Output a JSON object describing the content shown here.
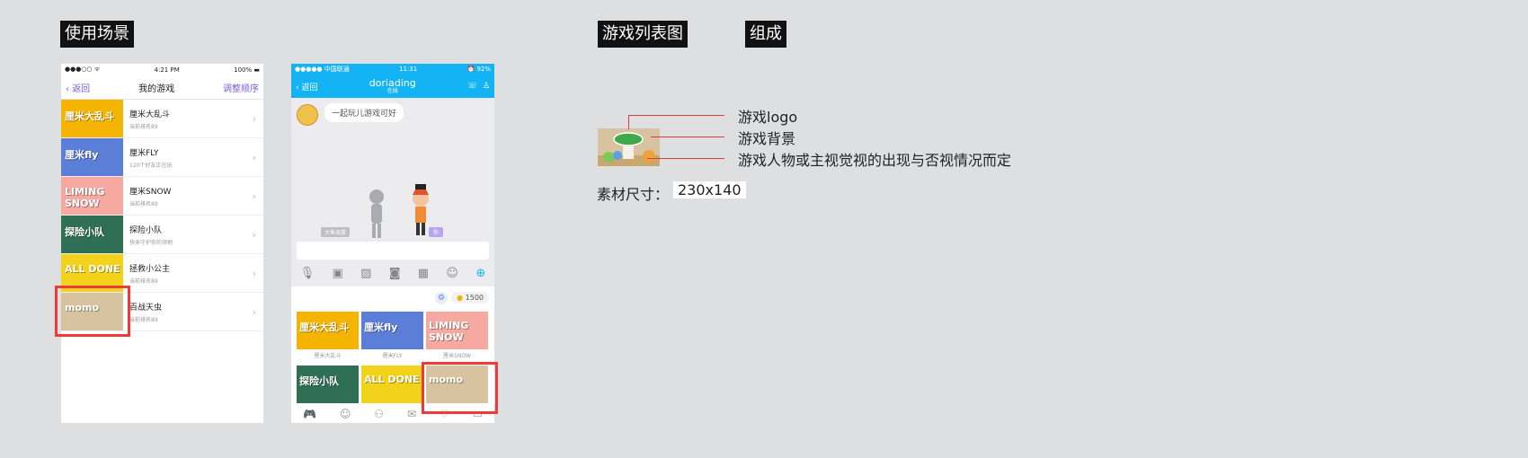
{
  "labels": {
    "usage": "使用场景",
    "list_icon": "游戏列表图",
    "composition": "组成"
  },
  "phone1": {
    "status_time": "4:21 PM",
    "status_battery": "100%",
    "back": "返回",
    "title": "我的游戏",
    "reorder": "调整顺序",
    "rows": [
      {
        "name": "厘米大乱斗",
        "sub": "当前排名89",
        "art": "厘米大乱斗",
        "color": "#f4b400"
      },
      {
        "name": "厘米FLY",
        "sub": "120个好友正在玩",
        "art": "厘米fly",
        "color": "#5b7ed9"
      },
      {
        "name": "厘米SNOW",
        "sub": "当前排名89",
        "art": "LIMING SNOW",
        "color": "#f6a9a0"
      },
      {
        "name": "探险小队",
        "sub": "快来守护你的领地",
        "art": "探险小队",
        "color": "#2f6f55"
      },
      {
        "name": "拯救小公主",
        "sub": "当前排名89",
        "art": "ALL DONE",
        "color": "#f3d21b"
      },
      {
        "name": "百战天虫",
        "sub": "当前排名89",
        "art": "momo",
        "color": "#d8c3a0"
      }
    ]
  },
  "phone2": {
    "status_carrier": "●●●●● 中国联通",
    "status_time": "11:31",
    "status_battery": "92%",
    "back": "返回",
    "title": "doriading",
    "subtitle": "在线",
    "bubble": "一起玩儿游戏可好",
    "left_tag": "大鱼海棠",
    "right_tag": "你",
    "coins": "1500",
    "tiles": [
      {
        "art": "厘米大乱斗",
        "caption": "厘米大乱斗",
        "color": "#f4b400"
      },
      {
        "art": "厘米fly",
        "caption": "厘米FLY",
        "color": "#5b7ed9"
      },
      {
        "art": "LIMING SNOW",
        "caption": "厘米SNOW",
        "color": "#f6a9a0"
      },
      {
        "art": "探险小队",
        "caption": "",
        "color": "#2f6f55"
      },
      {
        "art": "ALL DONE",
        "caption": "",
        "color": "#f3d21b"
      },
      {
        "art": "momo",
        "caption": "",
        "color": "#d8c3a0"
      }
    ]
  },
  "composition": {
    "logo": "游戏logo",
    "background": "游戏背景",
    "character": "游戏人物或主视觉视的出现与否视情况而定",
    "size_label": "素材尺寸：",
    "size_value": "230x140"
  },
  "colors": {
    "page_bg": "#dedfe1",
    "highlight": "#f03a3a",
    "qq_blue": "#13b3f4",
    "accent_purple": "#7b5fe0"
  }
}
